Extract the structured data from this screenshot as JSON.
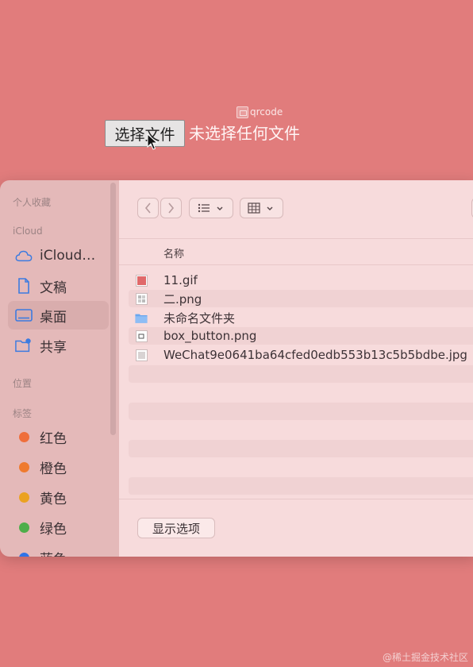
{
  "page": {
    "qrcode_alt": "qrcode",
    "file_button_label": "选择文件",
    "no_file_text": "未选择任何文件",
    "watermark": "@稀土掘金技术社区"
  },
  "sidebar": {
    "favorites_heading": "个人收藏",
    "icloud_heading": "iCloud",
    "icloud_items": [
      {
        "label": "iCloud…",
        "icon": "cloud-icon"
      },
      {
        "label": "文稿",
        "icon": "document-icon"
      },
      {
        "label": "桌面",
        "icon": "desktop-icon",
        "selected": true
      },
      {
        "label": "共享",
        "icon": "shared-folder-icon"
      }
    ],
    "locations_heading": "位置",
    "tags_heading": "标签",
    "tags": [
      {
        "label": "红色",
        "color": "#ef6e3b"
      },
      {
        "label": "橙色",
        "color": "#ef7a2e"
      },
      {
        "label": "黄色",
        "color": "#eba221"
      },
      {
        "label": "绿色",
        "color": "#4eae4a"
      },
      {
        "label": "蓝色",
        "color": "#2f73e8"
      }
    ]
  },
  "toolbar": {
    "back_icon": "chevron-left-icon",
    "forward_icon": "chevron-right-icon",
    "list_view_icon": "list-view-icon",
    "grid_view_icon": "grid-view-icon"
  },
  "file_list": {
    "column_name": "名称",
    "files": [
      {
        "name": "11.gif",
        "icon": "image-file-icon"
      },
      {
        "name": "二.png",
        "icon": "image-file-icon"
      },
      {
        "name": "未命名文件夹",
        "icon": "folder-icon"
      },
      {
        "name": "box_button.png",
        "icon": "image-file-icon"
      },
      {
        "name": "WeChat9e0641ba64cfed0edb553b13c5b5bdbe.jpg",
        "icon": "image-file-icon"
      }
    ]
  },
  "footer": {
    "options_label": "显示选项"
  }
}
